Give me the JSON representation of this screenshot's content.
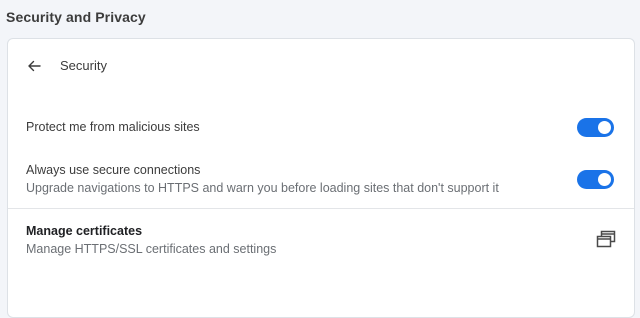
{
  "header": {
    "title": "Security and Privacy"
  },
  "subpage": {
    "title": "Security",
    "back_icon": "arrow-left-icon"
  },
  "settings": [
    {
      "label": "Protect me from malicious sites",
      "description": "",
      "toggle_on": true
    },
    {
      "label": "Always use secure connections",
      "description": "Upgrade navigations to HTTPS and warn you before loading sites that don't support it",
      "toggle_on": true
    }
  ],
  "certificates": {
    "label": "Manage certificates",
    "description": "Manage HTTPS/SSL certificates and settings",
    "icon": "open-in-new-window-icon"
  },
  "colors": {
    "accent": "#1a73e8",
    "page_bg": "#f3f5f9",
    "card_bg": "#ffffff"
  }
}
